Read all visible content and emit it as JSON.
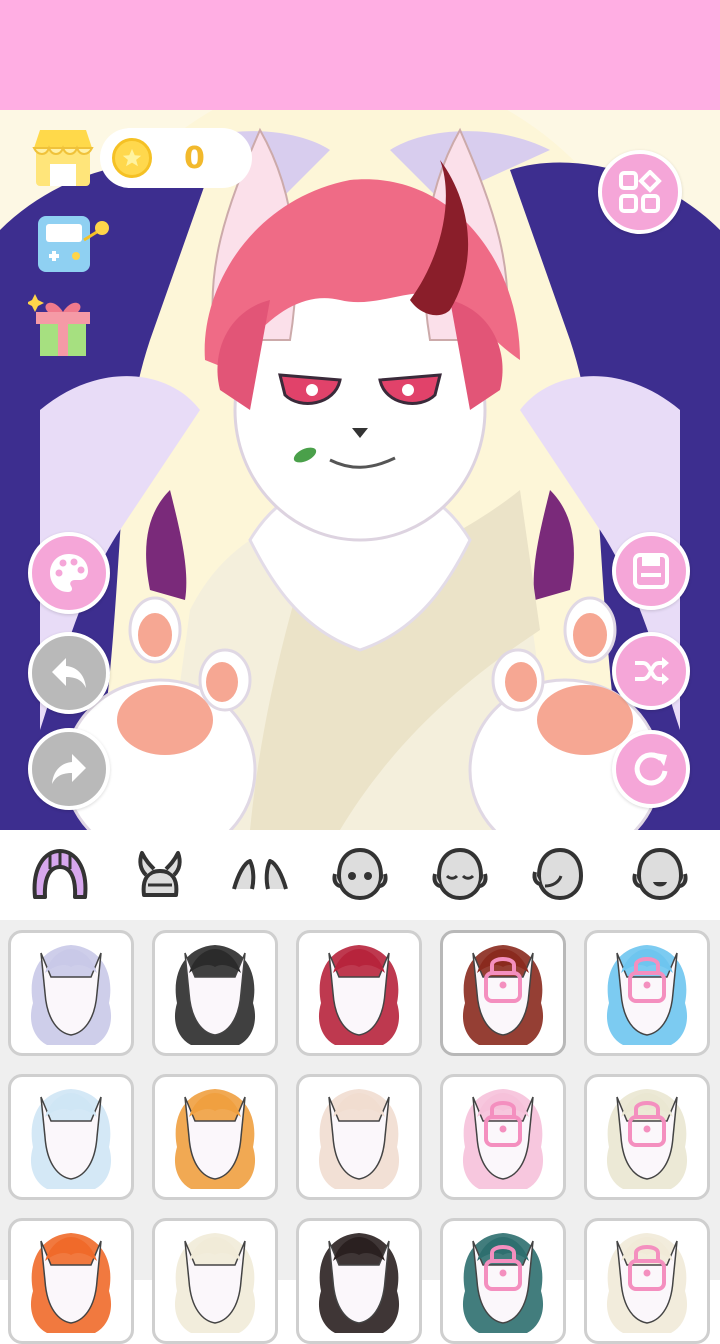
{
  "header": {
    "bg_color": "#ffaee3"
  },
  "coins": {
    "value": "0"
  },
  "left_tools": [
    {
      "name": "shop",
      "icon": "shop-icon"
    },
    {
      "name": "game",
      "icon": "game-console-icon"
    },
    {
      "name": "gift",
      "icon": "gift-icon"
    }
  ],
  "side_buttons": {
    "left": [
      "palette-icon",
      "undo-icon",
      "redo-icon"
    ],
    "right": [
      "save-icon",
      "shuffle-icon",
      "reset-icon"
    ]
  },
  "category_tabs": [
    {
      "name": "hair",
      "icon": "hair-icon",
      "active": true
    },
    {
      "name": "horns",
      "icon": "horns-icon"
    },
    {
      "name": "ears",
      "icon": "ears-icon"
    },
    {
      "name": "eyes",
      "icon": "face-eyes-icon"
    },
    {
      "name": "closed-eyes",
      "icon": "face-closed-eyes-icon"
    },
    {
      "name": "side-face",
      "icon": "face-side-icon"
    },
    {
      "name": "mouth",
      "icon": "face-mouth-icon"
    }
  ],
  "hair_options": [
    {
      "color": "#c9c9e8",
      "locked": false
    },
    {
      "color": "#2b2b2b",
      "locked": false
    },
    {
      "color": "#b7243c",
      "locked": false
    },
    {
      "color": "#8a2a1e",
      "locked": true
    },
    {
      "color": "#6ec5ef",
      "locked": true
    },
    {
      "color": "#cfe6f5",
      "locked": false
    },
    {
      "color": "#f0a040",
      "locked": false
    },
    {
      "color": "#f1ddd0",
      "locked": false
    },
    {
      "color": "#f6c1da",
      "locked": true
    },
    {
      "color": "#eae7d2",
      "locked": true
    },
    {
      "color": "#f06a2a",
      "locked": false
    },
    {
      "color": "#f1ebd8",
      "locked": false
    },
    {
      "color": "#2a2020",
      "locked": false
    },
    {
      "color": "#2e6f6f",
      "locked": true
    },
    {
      "color": "#f1ead8",
      "locked": true
    }
  ],
  "colors": {
    "accent": "#f5a6d8",
    "lock": "#f48fbf",
    "disabled": "#b9b9b9"
  }
}
